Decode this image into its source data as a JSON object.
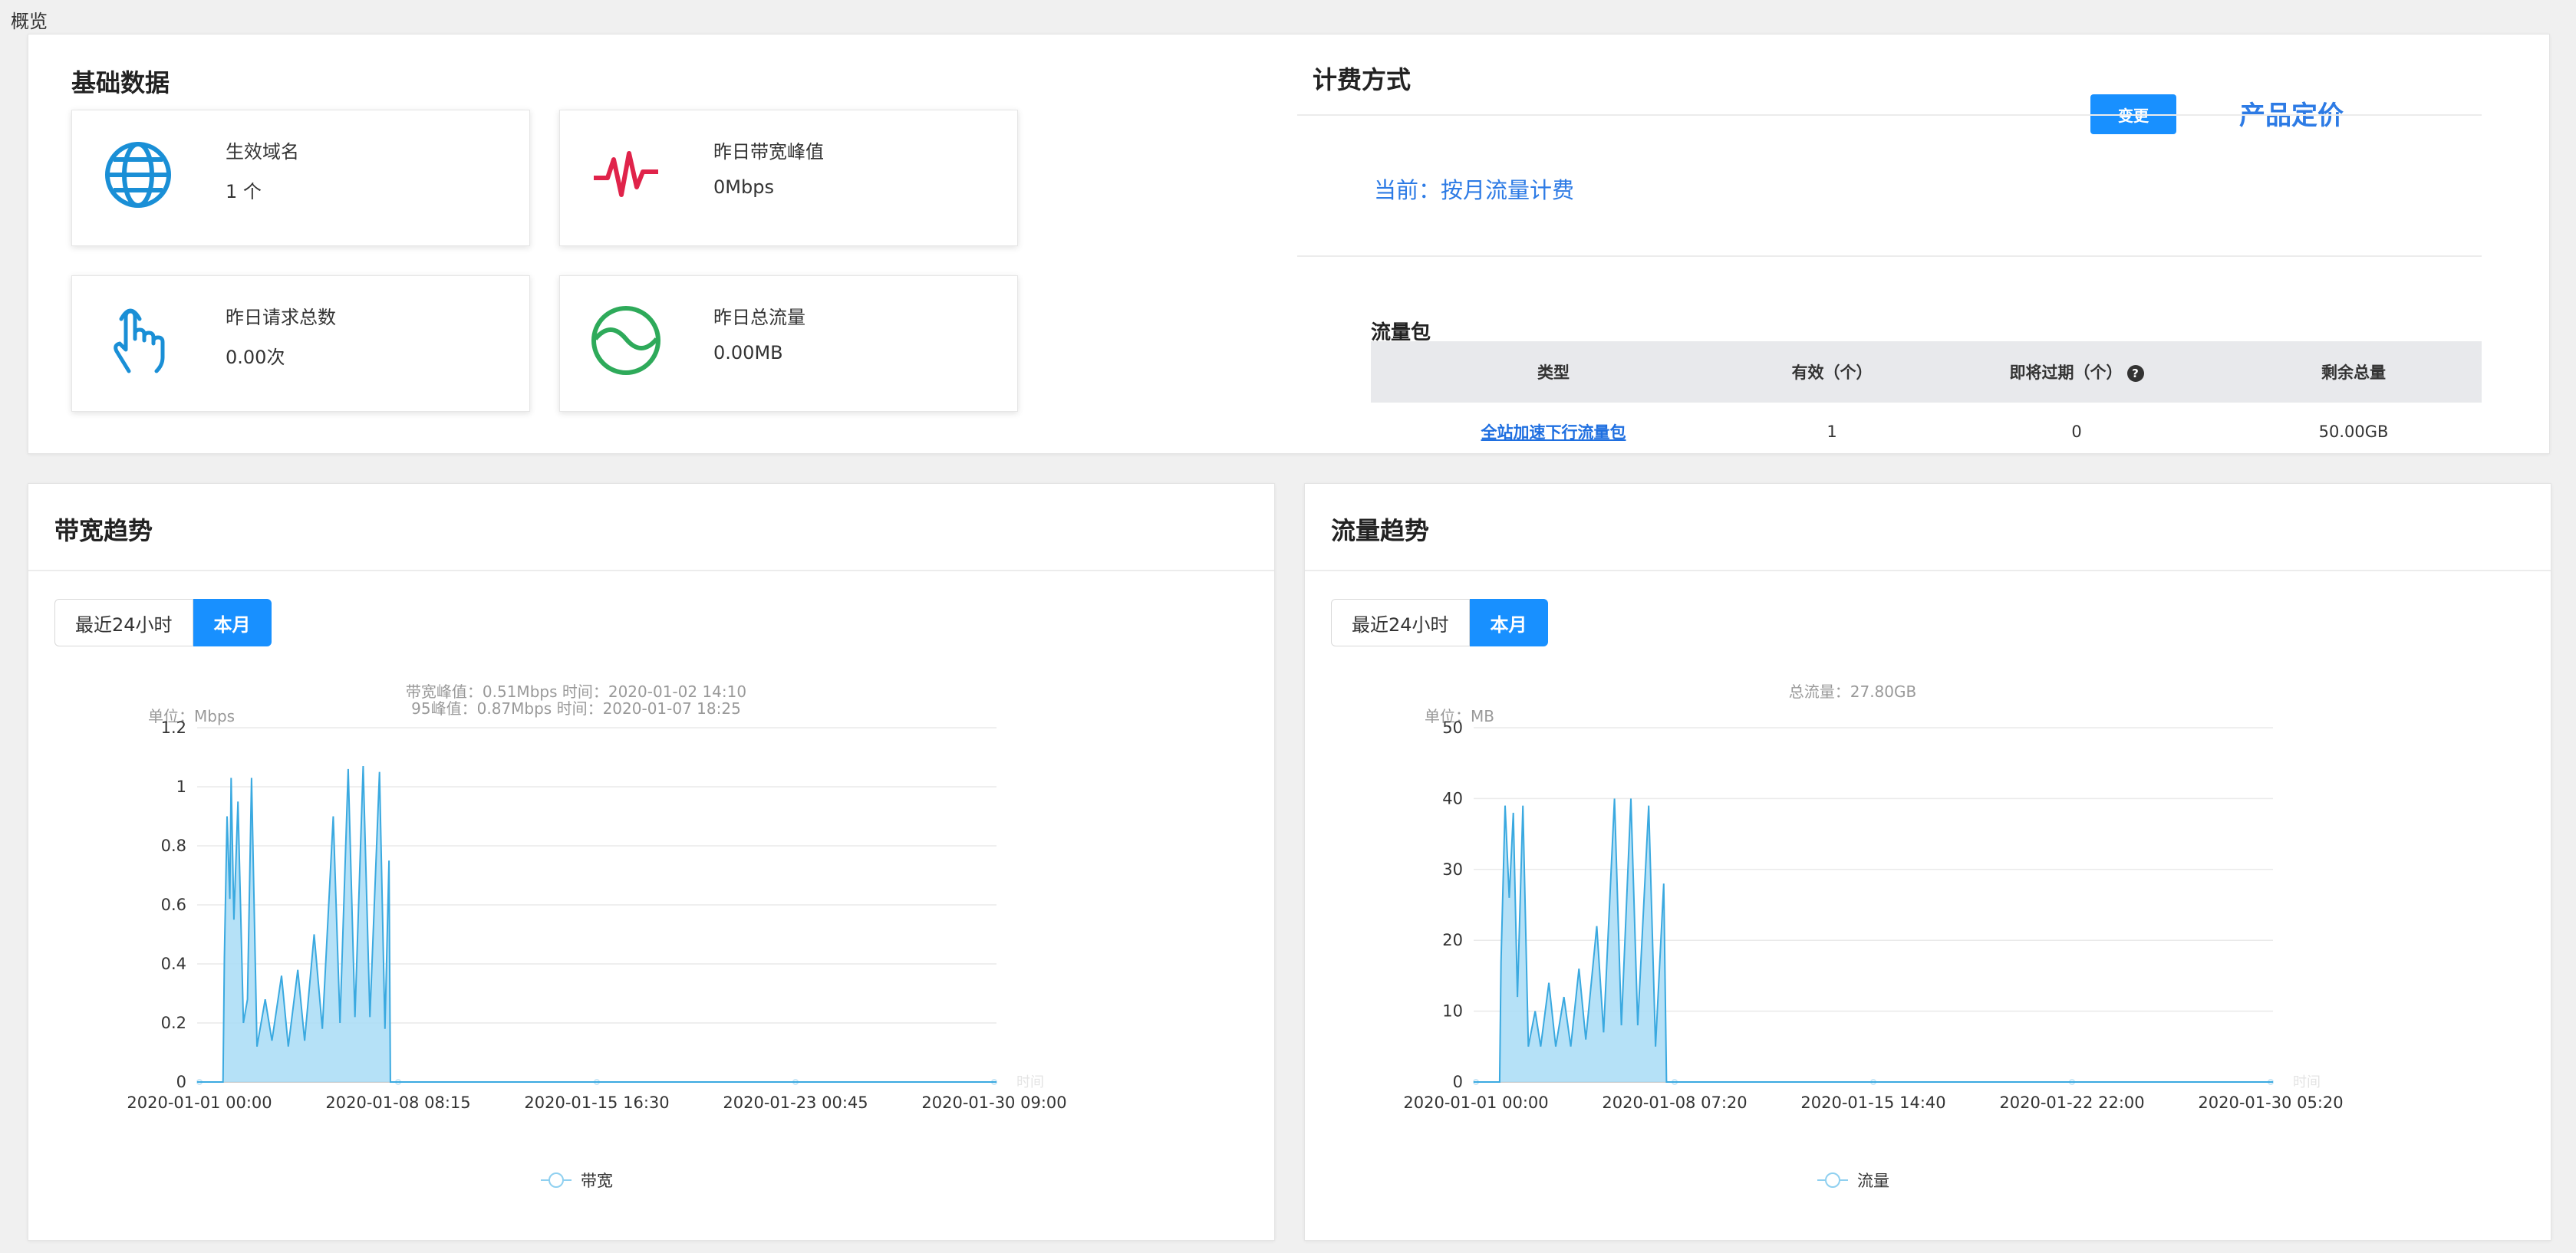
{
  "breadcrumb": "概览",
  "basic": {
    "title": "基础数据",
    "cards": [
      {
        "label": "生效域名",
        "value": "1 个",
        "icon": "globe-icon",
        "color": "#1a8fd6"
      },
      {
        "label": "昨日带宽峰值",
        "value": "0Mbps",
        "icon": "pulse-icon",
        "color": "#e0234a"
      },
      {
        "label": "昨日请求总数",
        "value": "0.00次",
        "icon": "hand-pointer-icon",
        "color": "#1a8fd6"
      },
      {
        "label": "昨日总流量",
        "value": "0.00MB",
        "icon": "wave-circle-icon",
        "color": "#2eaa5a"
      }
    ]
  },
  "billing": {
    "title": "计费方式",
    "change_label": "变更",
    "pricing_link": "产品定价",
    "current": "当前：按月流量计费",
    "package_title": "流量包",
    "columns": [
      "类型",
      "有效（个）",
      "即将过期（个）",
      "剩余总量"
    ],
    "help_glyph": "?",
    "rows": [
      [
        "全站加速下行流量包",
        "1",
        "0",
        "50.00GB"
      ]
    ]
  },
  "bandwidth_panel": {
    "title": "带宽趋势",
    "tabs": [
      "最近24小时",
      "本月"
    ],
    "active_tab": 1,
    "subtitle_lines": [
      "带宽峰值：0.51Mbps 时间：2020-01-02 14:10",
      "95峰值：0.87Mbps 时间：2020-01-07 18:25"
    ],
    "unit_label": "单位：Mbps",
    "legend": "带宽"
  },
  "traffic_panel": {
    "title": "流量趋势",
    "tabs": [
      "最近24小时",
      "本月"
    ],
    "active_tab": 1,
    "subtitle_lines": [
      "总流量：27.80GB"
    ],
    "unit_label": "单位：MB",
    "legend": "流量"
  },
  "chart_data": [
    {
      "type": "area",
      "title": "带宽趋势",
      "ylabel": "单位：Mbps",
      "xlabel": "时间",
      "ylim": [
        0,
        1.2
      ],
      "yticks": [
        0,
        0.2,
        0.4,
        0.6,
        0.8,
        1,
        1.2
      ],
      "xticks": [
        "2020-01-01 00:00",
        "2020-01-08 08:15",
        "2020-01-15 16:30",
        "2020-01-23 00:45",
        "2020-01-30 09:00"
      ],
      "x_range_days": [
        0,
        29.375
      ],
      "series": [
        {
          "name": "带宽",
          "color": "#3aa9e0",
          "fill": "#a8dcf6",
          "peaks_day_value": [
            [
              0.95,
              0.0
            ],
            [
              1.0,
              0.42
            ],
            [
              1.1,
              0.9
            ],
            [
              1.2,
              0.62
            ],
            [
              1.25,
              1.03
            ],
            [
              1.35,
              0.55
            ],
            [
              1.5,
              0.95
            ],
            [
              1.7,
              0.2
            ],
            [
              1.85,
              0.28
            ],
            [
              2.0,
              1.03
            ],
            [
              2.2,
              0.12
            ],
            [
              2.5,
              0.28
            ],
            [
              2.75,
              0.14
            ],
            [
              3.1,
              0.36
            ],
            [
              3.35,
              0.12
            ],
            [
              3.7,
              0.38
            ],
            [
              3.95,
              0.14
            ],
            [
              4.3,
              0.5
            ],
            [
              4.6,
              0.18
            ],
            [
              5.0,
              0.9
            ],
            [
              5.25,
              0.2
            ],
            [
              5.55,
              1.06
            ],
            [
              5.8,
              0.22
            ],
            [
              6.1,
              1.07
            ],
            [
              6.35,
              0.22
            ],
            [
              6.7,
              1.05
            ],
            [
              6.9,
              0.18
            ],
            [
              7.05,
              0.75
            ],
            [
              7.1,
              0.0
            ]
          ]
        }
      ]
    },
    {
      "type": "area",
      "title": "流量趋势",
      "ylabel": "单位：MB",
      "xlabel": "时间",
      "ylim": [
        0,
        50
      ],
      "yticks": [
        0,
        10,
        20,
        30,
        40,
        50
      ],
      "xticks": [
        "2020-01-01 00:00",
        "2020-01-08 07:20",
        "2020-01-15 14:40",
        "2020-01-22 22:00",
        "2020-01-30 05:20"
      ],
      "x_range_days": [
        0,
        29.222
      ],
      "series": [
        {
          "name": "流量",
          "color": "#3aa9e0",
          "fill": "#a8dcf6",
          "peaks_day_value": [
            [
              0.95,
              0.0
            ],
            [
              1.0,
              17
            ],
            [
              1.15,
              39
            ],
            [
              1.3,
              26
            ],
            [
              1.45,
              38
            ],
            [
              1.6,
              12
            ],
            [
              1.8,
              39
            ],
            [
              2.0,
              5
            ],
            [
              2.25,
              10
            ],
            [
              2.45,
              5
            ],
            [
              2.75,
              14
            ],
            [
              3.0,
              5
            ],
            [
              3.3,
              12
            ],
            [
              3.55,
              5
            ],
            [
              3.85,
              16
            ],
            [
              4.1,
              6
            ],
            [
              4.5,
              22
            ],
            [
              4.75,
              7
            ],
            [
              5.15,
              40
            ],
            [
              5.4,
              8
            ],
            [
              5.75,
              40
            ],
            [
              6.0,
              8
            ],
            [
              6.4,
              39
            ],
            [
              6.65,
              5
            ],
            [
              6.95,
              28
            ],
            [
              7.05,
              0
            ]
          ]
        }
      ]
    }
  ]
}
